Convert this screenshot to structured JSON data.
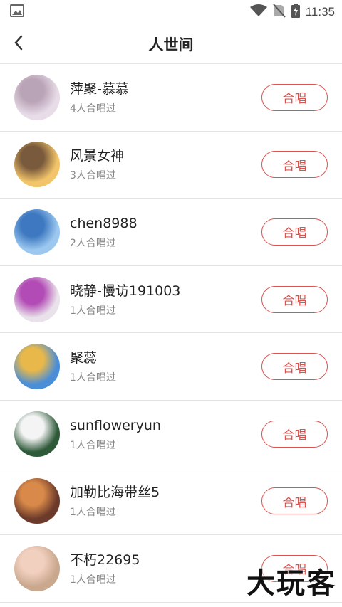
{
  "status_bar": {
    "time": "11:35",
    "icons": [
      "image-icon",
      "wifi-icon",
      "no-sim-icon",
      "battery-charging-icon"
    ]
  },
  "header": {
    "title": "人世间",
    "back_icon": "chevron-left-icon"
  },
  "button_label": "合唱",
  "items": [
    {
      "name": "萍聚-慕慕",
      "count": "4人合唱过",
      "avatar_colors": [
        "#e8dce8",
        "#b9a3b6"
      ]
    },
    {
      "name": "风景女神",
      "count": "3人合唱过",
      "avatar_colors": [
        "#f3c56a",
        "#7a5a3c"
      ]
    },
    {
      "name": "chen8988",
      "count": "2人合唱过",
      "avatar_colors": [
        "#9cc8f0",
        "#3d78c0"
      ]
    },
    {
      "name": "晓静-慢访191003",
      "count": "1人合唱过",
      "avatar_colors": [
        "#e9e2ea",
        "#b24bb5"
      ]
    },
    {
      "name": "聚蕊",
      "count": "1人合唱过",
      "avatar_colors": [
        "#4a8ed8",
        "#e8b84a"
      ]
    },
    {
      "name": "sunfloweryun",
      "count": "1人合唱过",
      "avatar_colors": [
        "#2f5a3a",
        "#f4f4f4"
      ]
    },
    {
      "name": "加勒比海带丝5",
      "count": "1人合唱过",
      "avatar_colors": [
        "#6b3a2a",
        "#d98a4a"
      ]
    },
    {
      "name": "不朽22695",
      "count": "1人合唱过",
      "avatar_colors": [
        "#c9a88e",
        "#f2d0c0"
      ]
    }
  ],
  "watermark": "大玩客",
  "accent_color": "#d9534f"
}
